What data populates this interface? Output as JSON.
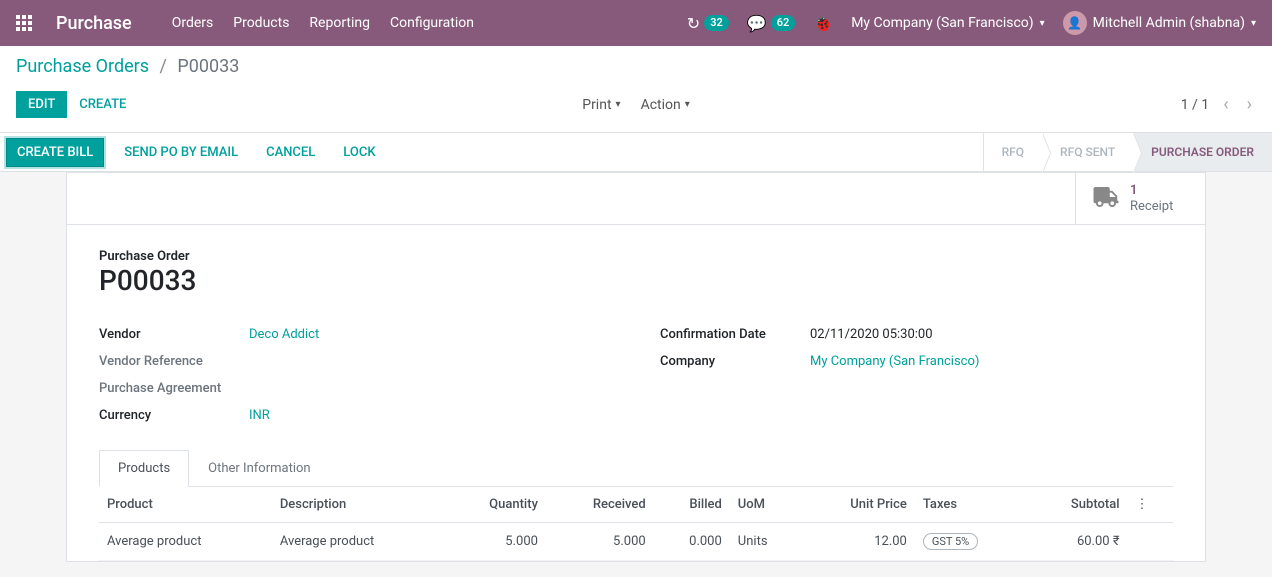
{
  "nav": {
    "brand": "Purchase",
    "menu": [
      "Orders",
      "Products",
      "Reporting",
      "Configuration"
    ],
    "clock_badge": "32",
    "chat_badge": "62",
    "company": "My Company (San Francisco)",
    "user": "Mitchell Admin (shabna)"
  },
  "breadcrumb": {
    "parent": "Purchase Orders",
    "current": "P00033"
  },
  "control": {
    "edit": "Edit",
    "create": "Create",
    "print": "Print",
    "action": "Action",
    "pager": "1 / 1"
  },
  "status_actions": {
    "create_bill": "Create Bill",
    "send_email": "Send PO by Email",
    "cancel": "Cancel",
    "lock": "Lock"
  },
  "stages": [
    "RFQ",
    "RFQ SENT",
    "PURCHASE ORDER"
  ],
  "stat_button": {
    "count": "1",
    "label": "Receipt"
  },
  "record": {
    "title_label": "Purchase Order",
    "name": "P00033",
    "labels": {
      "vendor": "Vendor",
      "vendor_ref": "Vendor Reference",
      "purchase_agreement": "Purchase Agreement",
      "currency": "Currency",
      "confirm_date": "Confirmation Date",
      "company": "Company"
    },
    "vendor": "Deco Addict",
    "currency": "INR",
    "confirm_date": "02/11/2020 05:30:00",
    "company": "My Company (San Francisco)"
  },
  "tabs": {
    "products": "Products",
    "other": "Other Information"
  },
  "table": {
    "headers": {
      "product": "Product",
      "description": "Description",
      "quantity": "Quantity",
      "received": "Received",
      "billed": "Billed",
      "uom": "UoM",
      "unit_price": "Unit Price",
      "taxes": "Taxes",
      "subtotal": "Subtotal"
    },
    "row": {
      "product": "Average product",
      "description": "Average product",
      "quantity": "5.000",
      "received": "5.000",
      "billed": "0.000",
      "uom": "Units",
      "unit_price": "12.00",
      "tax": "GST 5%",
      "subtotal": "60.00 ₹"
    }
  }
}
